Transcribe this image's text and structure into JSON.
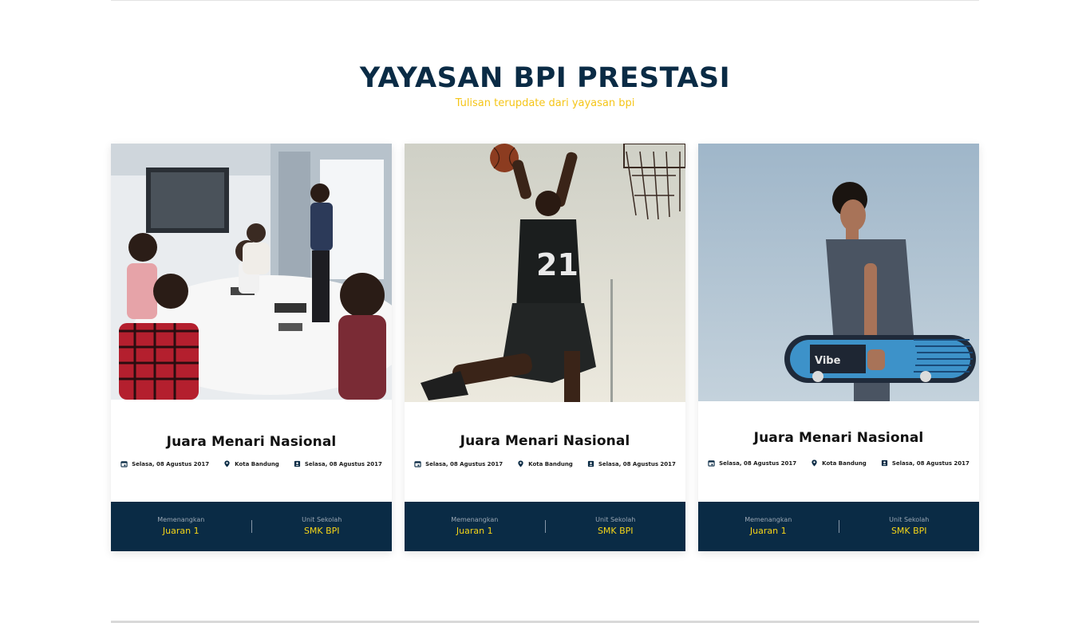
{
  "section": {
    "title": "YAYASAN BPI PRESTASI",
    "subtitle": "Tulisan terupdate dari yayasan bpi"
  },
  "colors": {
    "navy": "#0a2b45",
    "accent_yellow": "#f5c518"
  },
  "cards": [
    {
      "title": "Juara Menari Nasional",
      "date": "Selasa, 08 Agustus 2017",
      "location": "Kota Bandung",
      "date2": "Selasa, 08 Agustus 2017",
      "win_label": "Memenangkan",
      "win_value": "Juaran 1",
      "unit_label": "Unit Sekolah",
      "unit_value": "SMK BPI",
      "image": "office-meeting-photo"
    },
    {
      "title": "Juara Menari Nasional",
      "date": "Selasa, 08 Agustus 2017",
      "location": "Kota Bandung",
      "date2": "Selasa, 08 Agustus 2017",
      "win_label": "Memenangkan",
      "win_value": "Juaran 1",
      "unit_label": "Unit Sekolah",
      "unit_value": "SMK BPI",
      "image": "basketball-player-photo"
    },
    {
      "title": "Juara Menari Nasional",
      "date": "Selasa, 08 Agustus 2017",
      "location": "Kota Bandung",
      "date2": "Selasa, 08 Agustus 2017",
      "win_label": "Memenangkan",
      "win_value": "Juaran 1",
      "unit_label": "Unit Sekolah",
      "unit_value": "SMK BPI",
      "image": "skateboarder-photo"
    }
  ],
  "icons": {
    "date": "calendar-icon",
    "location": "map-pin-icon",
    "date2": "contact-card-icon"
  }
}
